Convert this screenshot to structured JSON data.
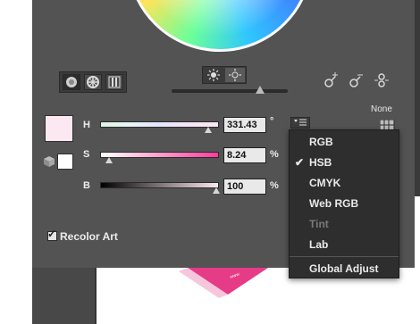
{
  "colors": {
    "panel": "#535353",
    "fill_swatch": "#fce8f1",
    "menu_bg": "#2e2e2e"
  },
  "modes": [
    {
      "name": "hsb-wheel-mode",
      "icon": "smooth-wheel-icon"
    },
    {
      "name": "segmented-wheel-mode",
      "icon": "segmented-wheel-icon"
    },
    {
      "name": "color-bars-mode",
      "icon": "color-bars-icon"
    }
  ],
  "brightness_buttons": [
    "show-brightness-icon",
    "show-saturation-icon"
  ],
  "link_tools": [
    "add-color-tool-icon",
    "remove-color-tool-icon",
    "unlink-harmony-icon"
  ],
  "none_label": "None",
  "channels": {
    "h": {
      "label": "H",
      "value": "331.43",
      "unit": "°",
      "fraction": 0.92
    },
    "s": {
      "label": "S",
      "value": "8.24",
      "unit": "%",
      "fraction": 0.08
    },
    "b": {
      "label": "B",
      "value": "100",
      "unit": "%",
      "fraction": 1.0
    }
  },
  "menu": {
    "items": [
      {
        "label": "RGB",
        "checked": false,
        "disabled": false
      },
      {
        "label": "HSB",
        "checked": true,
        "disabled": false
      },
      {
        "label": "CMYK",
        "checked": false,
        "disabled": false
      },
      {
        "label": "Web RGB",
        "checked": false,
        "disabled": false
      },
      {
        "label": "Tint",
        "checked": false,
        "disabled": true
      },
      {
        "label": "Lab",
        "checked": false,
        "disabled": false
      },
      {
        "label": "Global Adjust",
        "checked": false,
        "disabled": false
      }
    ]
  },
  "recolor_art": {
    "label": "Recolor Art",
    "checked": true
  }
}
